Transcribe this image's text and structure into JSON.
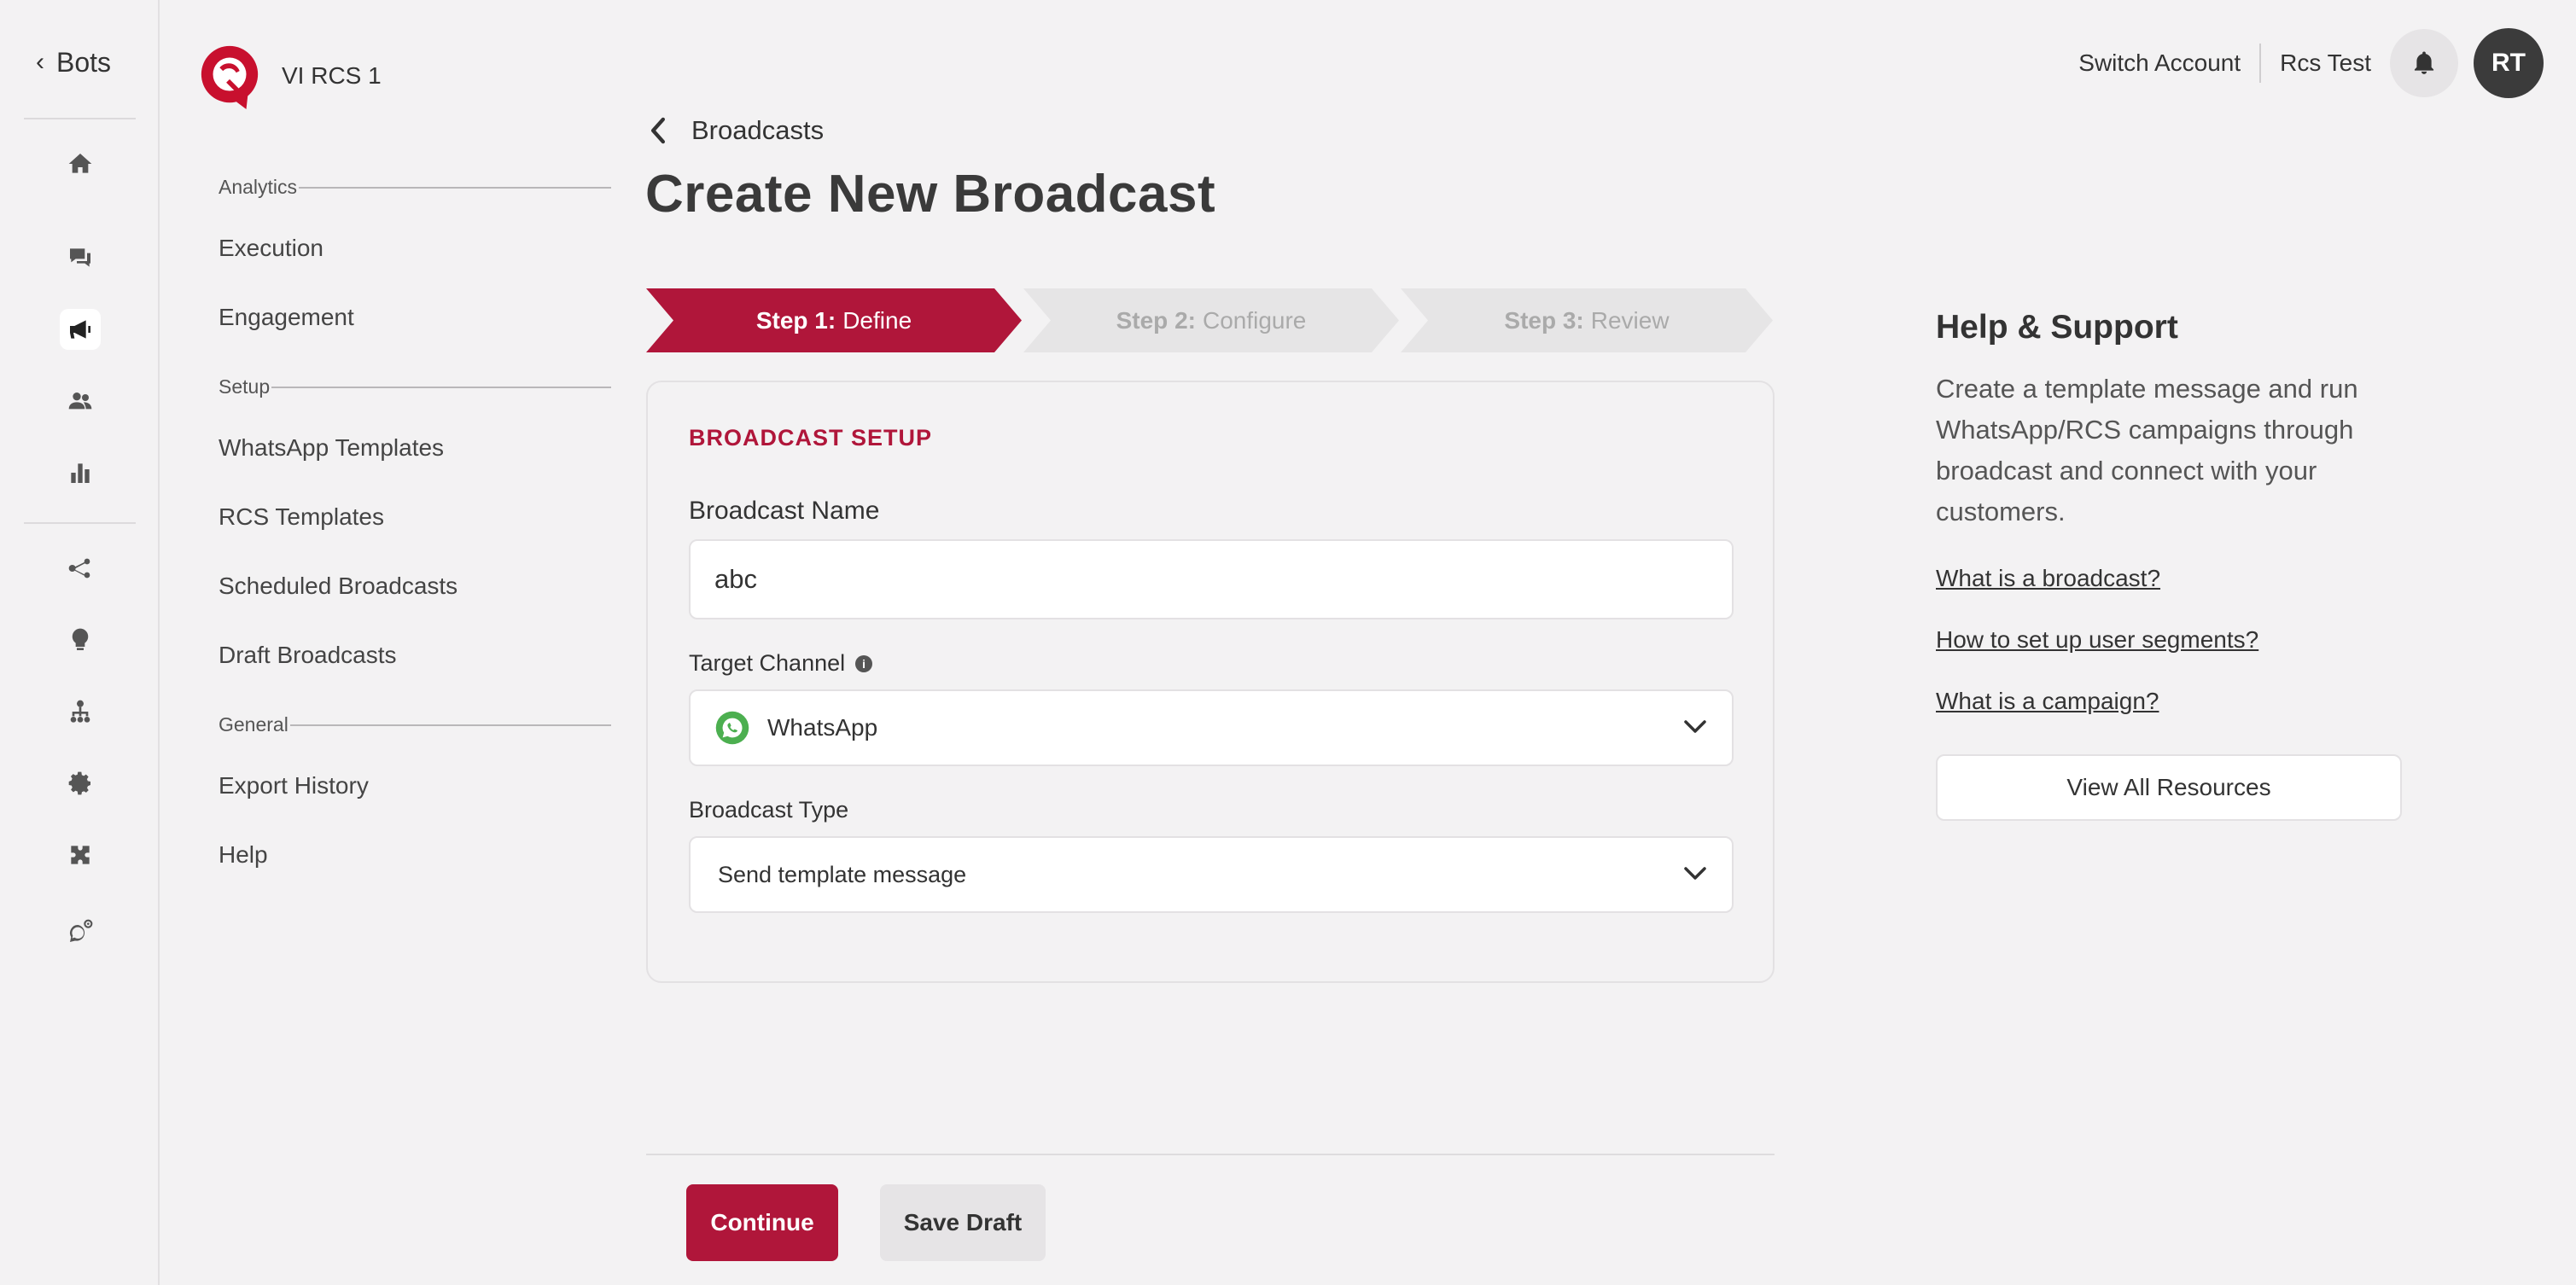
{
  "rail": {
    "back_label": "Bots",
    "icons": [
      "home-icon",
      "chat-icon",
      "megaphone-icon",
      "users-icon",
      "bar-chart-icon",
      "flow-icon",
      "bulb-icon",
      "org-icon",
      "gear-icon",
      "puzzle-icon",
      "whatsapp-settings-icon"
    ],
    "active": "megaphone-icon"
  },
  "brand": {
    "name": "VI RCS 1"
  },
  "sidebar": {
    "sections": [
      {
        "title": "Analytics",
        "items": [
          "Execution",
          "Engagement"
        ]
      },
      {
        "title": "Setup",
        "items": [
          "WhatsApp Templates",
          "RCS Templates",
          "Scheduled Broadcasts",
          "Draft Broadcasts"
        ]
      },
      {
        "title": "General",
        "items": [
          "Export History",
          "Help"
        ]
      }
    ]
  },
  "topbar": {
    "switch_account": "Switch Account",
    "user_name": "Rcs Test",
    "avatar_initials": "RT"
  },
  "breadcrumb": {
    "label": "Broadcasts"
  },
  "page": {
    "title": "Create New Broadcast"
  },
  "stepper": {
    "steps": [
      {
        "prefix": "Step 1:",
        "label": "Define",
        "active": true
      },
      {
        "prefix": "Step 2:",
        "label": "Configure",
        "active": false
      },
      {
        "prefix": "Step 3:",
        "label": "Review",
        "active": false
      }
    ]
  },
  "form": {
    "section_title": "BROADCAST SETUP",
    "name_label": "Broadcast Name",
    "name_value": "abc",
    "channel_label": "Target Channel",
    "channel_value": "WhatsApp",
    "type_label": "Broadcast Type",
    "type_value": "Send template message"
  },
  "actions": {
    "continue": "Continue",
    "save_draft": "Save Draft"
  },
  "help": {
    "title": "Help & Support",
    "body": "Create a template message and run WhatsApp/RCS campaigns through broadcast and connect with your customers.",
    "links": [
      "What is a broadcast?",
      "How to set up user segments?",
      "What is a campaign?"
    ],
    "resources_button": "View All Resources"
  },
  "colors": {
    "accent": "#b0163a",
    "background": "#f3f2f3",
    "whatsapp": "#4caf50"
  }
}
